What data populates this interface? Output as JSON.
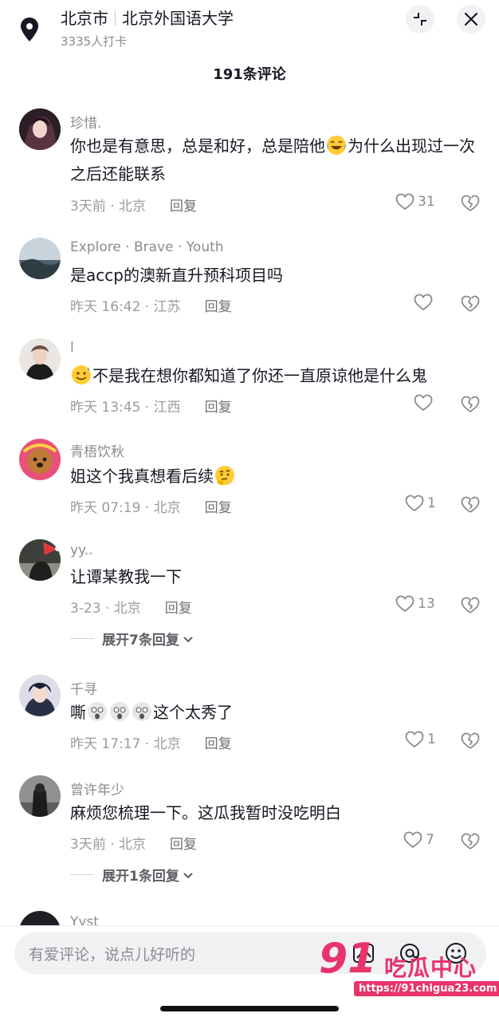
{
  "header": {
    "city": "北京市",
    "place": "北京外国语大学",
    "checkins": "3335人打卡"
  },
  "comment_count_title": "191条评论",
  "comments": [
    {
      "user": "珍惜.",
      "text_a": "你也是有意思，总是和好，总是陪他",
      "emoji": "laughing-crying",
      "text_b": "为什么出现过一次之后还能联系",
      "time": "3天前 · 北京",
      "reply": "回复",
      "likes": "31"
    },
    {
      "user": "Explore · Brave · Youth",
      "text_a": "是accp的澳新直升预科项目吗",
      "time": "昨天 16:42 · 江苏",
      "reply": "回复",
      "likes": ""
    },
    {
      "user": "l",
      "emoji": "smile-sweat",
      "text_a": "不是我在想你都知道了你还一直原谅他是什么鬼",
      "time": "昨天 13:45 · 江西",
      "reply": "回复",
      "likes": ""
    },
    {
      "user": "青梧饮秋",
      "text_a": "姐这个我真想看后续",
      "emoji": "thinking",
      "time": "昨天 07:19 · 北京",
      "reply": "回复",
      "likes": "1"
    },
    {
      "user": "yy..",
      "text_a": "让谭某教我一下",
      "time": "3-23 · 北京",
      "reply": "回复",
      "likes": "13",
      "expand": "展开7条回复"
    },
    {
      "user": "千寻",
      "text_a": "嘶",
      "emoji": "shocked",
      "text_b": "这个太秀了",
      "time": "昨天 17:17 · 北京",
      "reply": "回复",
      "likes": "1"
    },
    {
      "user": "曾许年少",
      "text_a": "麻烦您梳理一下。这瓜我暂时没吃明白",
      "time": "3天前 · 北京",
      "reply": "回复",
      "likes": "7",
      "expand": "展开1条回复"
    },
    {
      "user": "Yyst"
    }
  ],
  "input": {
    "placeholder": "有爱评论，说点儿好听的"
  },
  "watermark": {
    "brand": "吃瓜中心",
    "url": "https://91chigua23.com",
    "number": "91"
  },
  "colors": {
    "text": "#161823",
    "muted": "#8a8b91",
    "accent": "#e8336b",
    "input_bg": "#f1f1f3"
  },
  "icons": [
    "location-pin-icon",
    "collapse-icon",
    "close-icon",
    "heart-icon",
    "broken-heart-icon",
    "chevron-down-icon",
    "image-icon",
    "mention-icon",
    "emoji-icon"
  ]
}
